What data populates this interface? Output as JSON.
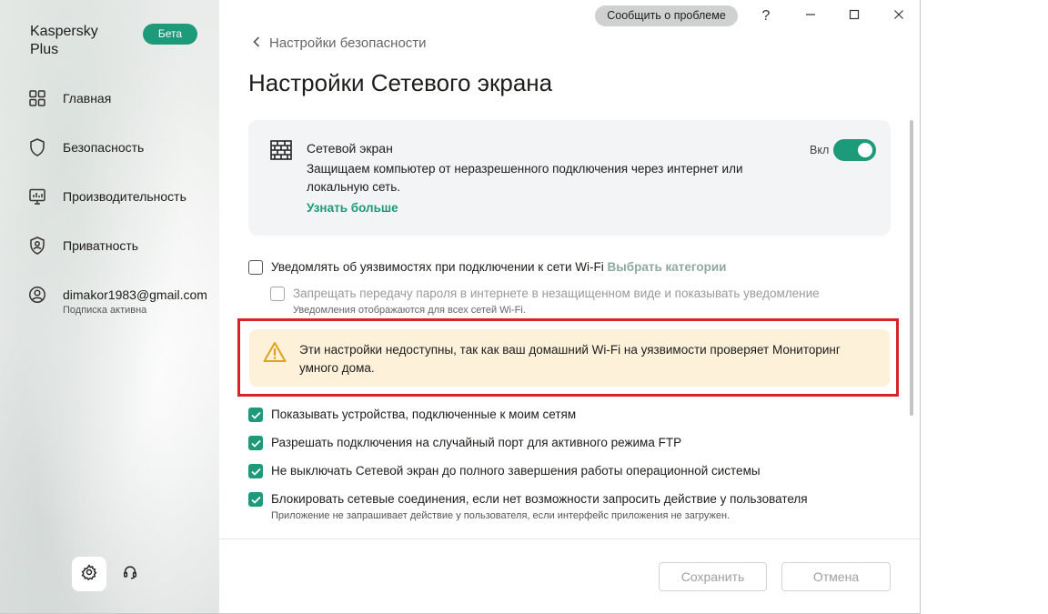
{
  "app": {
    "brand": "Kaspersky\nPlus",
    "beta_badge": "Бета"
  },
  "sidebar": {
    "items": [
      {
        "label": "Главная",
        "icon": "dashboard-icon"
      },
      {
        "label": "Безопасность",
        "icon": "shield-icon"
      },
      {
        "label": "Производительность",
        "icon": "performance-icon"
      },
      {
        "label": "Приватность",
        "icon": "privacy-icon"
      }
    ],
    "account": {
      "email": "dimakor1983@gmail.com",
      "status": "Подписка активна",
      "icon": "user-icon"
    },
    "bottom_buttons": [
      {
        "icon": "gear-icon",
        "active": true
      },
      {
        "icon": "headset-icon",
        "active": false
      }
    ]
  },
  "titlebar": {
    "report_problem": "Сообщить о проблеме",
    "help": "?",
    "controls": [
      "minimize-icon",
      "maximize-icon",
      "close-icon"
    ]
  },
  "main": {
    "breadcrumb": "Настройки безопасности",
    "title": "Настройки Сетевого экрана",
    "firewall_card": {
      "title": "Сетевой экран",
      "description": "Защищаем компьютер от неразрешенного подключения через интернет или локальную сеть.",
      "learn_more": "Узнать больше",
      "toggle_label": "Вкл",
      "toggle_on": true
    },
    "wifi_notify": {
      "label": "Уведомлять об уязвимостях при подключении к сети Wi-Fi",
      "link": "Выбрать категории",
      "checked": false,
      "disabled": false
    },
    "block_password": {
      "label": "Запрещать передачу пароля в интернете в незащищенном виде и показывать уведомление",
      "sub": "Уведомления отображаются для всех сетей Wi-Fi.",
      "checked": false,
      "disabled": true
    },
    "warning": {
      "text": "Эти настройки недоступны, так как ваш домашний Wi-Fi на уязвимости проверяет Мониторинг умного дома.",
      "icon": "warning-icon"
    },
    "options": [
      {
        "label": "Показывать устройства, подключенные к моим сетям",
        "checked": true
      },
      {
        "label": "Разрешать подключения на случайный порт для активного режима FTP",
        "checked": true
      },
      {
        "label": "Не выключать Сетевой экран до полного завершения работы операционной системы",
        "checked": true
      },
      {
        "label": "Блокировать сетевые соединения, если нет возможности запросить действие у пользователя",
        "checked": true,
        "sub": "Приложение не запрашивает действие у пользователя, если интерфейс приложения не загружен."
      }
    ],
    "footer": {
      "save": "Сохранить",
      "cancel": "Отмена"
    }
  },
  "colors": {
    "accent": "#1d9a7a",
    "warning_bg": "#fdf1da",
    "highlight_border": "#d8232a"
  }
}
